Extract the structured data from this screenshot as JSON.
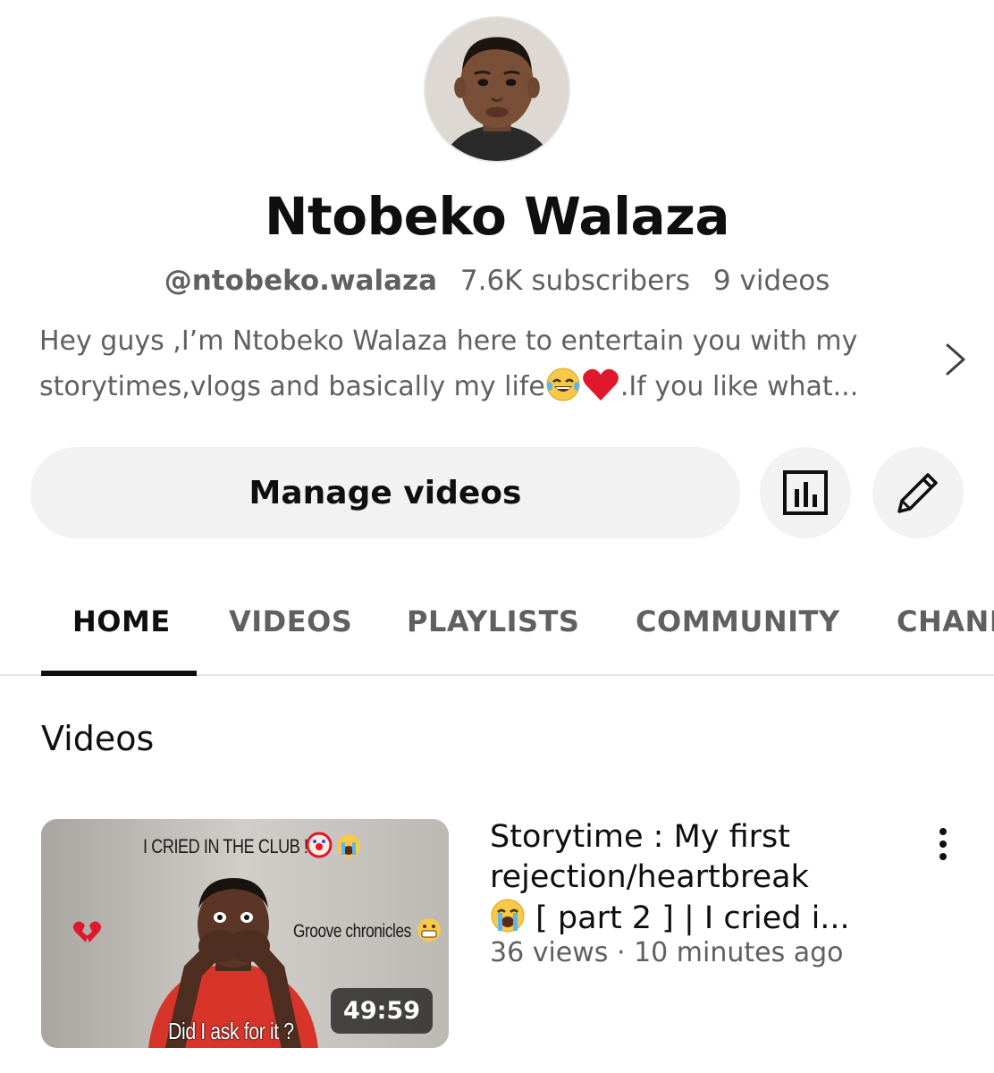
{
  "channel": {
    "name": "Ntobeko Walaza",
    "handle": "@ntobeko.walaza",
    "subscribers": "7.6K subscribers",
    "videos_count": "9 videos",
    "description_line1": "Hey guys ,I’m Ntobeko Walaza here to entertain you with my",
    "description_line2_a": "storytimes,vlogs and basically my life",
    "description_line2_b": ".If you like what..."
  },
  "actions": {
    "manage_label": "Manage videos"
  },
  "tabs": [
    {
      "label": "HOME",
      "active": true
    },
    {
      "label": "VIDEOS",
      "active": false
    },
    {
      "label": "PLAYLISTS",
      "active": false
    },
    {
      "label": "COMMUNITY",
      "active": false
    },
    {
      "label": "CHANN",
      "active": false
    }
  ],
  "section": {
    "title": "Videos"
  },
  "video": {
    "thumb_top_text": "I CRIED IN THE CLUB !",
    "thumb_right_text": "Groove chronicles",
    "thumb_bottom_text": "Did I ask for it ?",
    "duration": "49:59",
    "title_line1": "Storytime : My first",
    "title_line2": "rejection/heartbreak",
    "title_line3": " [ part 2 ] | I cried i...",
    "views": "36 views",
    "separator": "·",
    "age": "10 minutes ago"
  },
  "icons": {
    "analytics": "bar-chart-icon",
    "edit": "pencil-icon",
    "expand": "chevron-right-icon",
    "more": "more-vertical-icon"
  },
  "colors": {
    "text_primary": "#0f0f0f",
    "text_secondary": "#606060",
    "button_bg": "#f2f2f2",
    "heart": "#e0182d"
  }
}
